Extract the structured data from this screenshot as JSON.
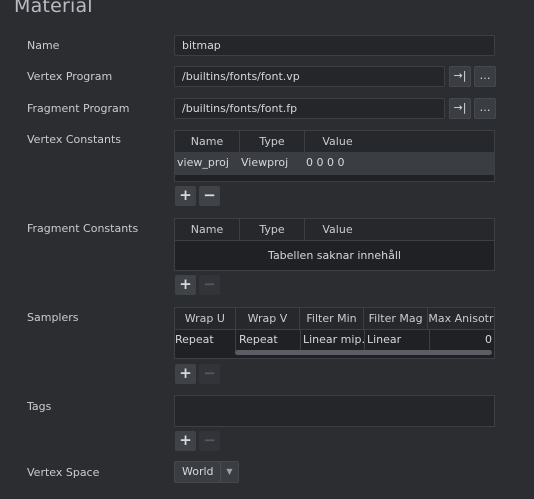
{
  "title": "Material",
  "name": {
    "label": "Name",
    "value": "bitmap"
  },
  "vertex_program": {
    "label": "Vertex Program",
    "value": "/builtins/fonts/font.vp"
  },
  "fragment_program": {
    "label": "Fragment Program",
    "value": "/builtins/fonts/font.fp"
  },
  "buttons": {
    "goto": "→|",
    "browse": "…",
    "add": "+",
    "remove": "−"
  },
  "vertex_constants": {
    "label": "Vertex Constants",
    "columns": [
      "Name",
      "Type",
      "Value"
    ],
    "rows": [
      {
        "name": "view_proj",
        "type": "Viewproj",
        "value": "0 0 0 0"
      }
    ]
  },
  "fragment_constants": {
    "label": "Fragment Constants",
    "columns": [
      "Name",
      "Type",
      "Value"
    ],
    "empty_text": "Tabellen saknar innehåll"
  },
  "samplers": {
    "label": "Samplers",
    "columns": [
      "Wrap U",
      "Wrap V",
      "Filter Min",
      "Filter Mag",
      "Max Anisotr…"
    ],
    "rows": [
      {
        "wrap_u": "Repeat",
        "wrap_v": "Repeat",
        "filter_min": "Linear mip…",
        "filter_mag": "Linear",
        "max_aniso": "0"
      }
    ]
  },
  "tags": {
    "label": "Tags"
  },
  "vertex_space": {
    "label": "Vertex Space",
    "value": "World"
  }
}
